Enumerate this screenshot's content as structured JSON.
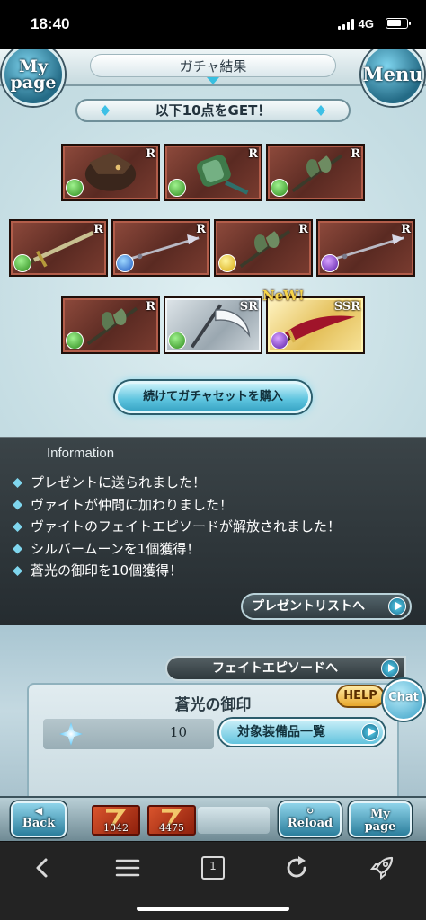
{
  "status_bar": {
    "time": "18:40",
    "network": "4G"
  },
  "header": {
    "title": "ガチャ結果",
    "mypage_label_1": "My",
    "mypage_label_2": "page",
    "menu_label": "Menu"
  },
  "result_banner": "以下10点をGET！",
  "items": [
    {
      "rarity": "R",
      "element": "wind",
      "weapon_type": "summon"
    },
    {
      "rarity": "R",
      "element": "wind",
      "weapon_type": "gauntlet"
    },
    {
      "rarity": "R",
      "element": "wind",
      "weapon_type": "axe"
    },
    {
      "rarity": "R",
      "element": "wind",
      "weapon_type": "sword"
    },
    {
      "rarity": "R",
      "element": "water",
      "weapon_type": "spear"
    },
    {
      "rarity": "R",
      "element": "light",
      "weapon_type": "axe"
    },
    {
      "rarity": "R",
      "element": "dark",
      "weapon_type": "spear"
    },
    {
      "rarity": "R",
      "element": "wind",
      "weapon_type": "axe"
    },
    {
      "rarity": "SR",
      "element": "wind",
      "weapon_type": "scythe"
    },
    {
      "rarity": "SSR",
      "element": "dark",
      "weapon_type": "dagger"
    }
  ],
  "new_tag": "NeW!",
  "buy_again_label": "続けてガチャセットを購入",
  "information": {
    "title": "Information",
    "messages": [
      "プレゼントに送られました！",
      "ヴァイトが仲間に加わりました！",
      "ヴァイトのフェイトエピソードが解放されました！",
      "シルバームーンを1個獲得！",
      "蒼光の御印を10個獲得！"
    ],
    "present_list_label": "プレゼントリストへ"
  },
  "fate_episode_label": "フェイトエピソードへ",
  "seal": {
    "title": "蒼光の御印",
    "count": "10",
    "equip_list_label": "対象装備品一覧",
    "help_label": "HELP",
    "chat_label": "Chat"
  },
  "footer": {
    "back_label": "Back",
    "ticket1_value": "1042",
    "ticket2_value": "4475",
    "reload_label": "Reload",
    "mypage_label_1": "My",
    "mypage_label_2": "page"
  },
  "browser_toolbar": {
    "tab_count": "1"
  },
  "colors": {
    "wind": "#3a9a28",
    "water": "#2a66cc",
    "light": "#d9ac14",
    "dark": "#6a2ab8",
    "accent": "#37bfe0"
  }
}
